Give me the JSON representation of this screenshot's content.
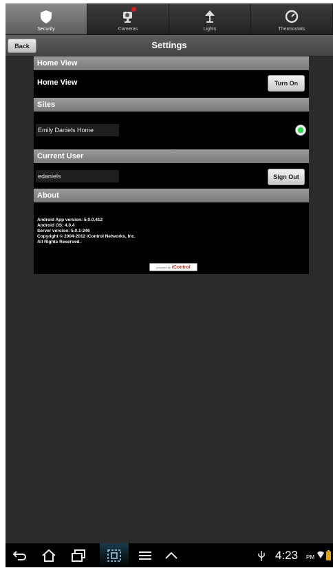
{
  "tabs": [
    {
      "label": "Security",
      "icon": "shield-icon",
      "active": true
    },
    {
      "label": "Cameras",
      "icon": "camera-icon",
      "active": false,
      "alert": true
    },
    {
      "label": "Lights",
      "icon": "lamp-icon",
      "active": false
    },
    {
      "label": "Thermostats",
      "icon": "thermostat-icon",
      "active": false
    }
  ],
  "titlebar": {
    "back_label": "Back",
    "title": "Settings"
  },
  "home_view": {
    "header": "Home View",
    "label": "Home View",
    "button": "Turn On"
  },
  "sites": {
    "header": "Sites",
    "site_name": "Emily Daniels Home",
    "selected": true
  },
  "current_user": {
    "header": "Current User",
    "username": "edaniels",
    "button": "Sign Out"
  },
  "about": {
    "header": "About",
    "lines": [
      "Android App version: 5.0.0.412",
      "Android OS: 4.0.4",
      "Server version: 5.0.1-246",
      "Copyright © 2004-2012 iControl Networks, Inc.",
      "All Rights Reserved."
    ],
    "logo_small": "powered by",
    "logo_text": "iControl"
  },
  "statusbar": {
    "time": "4:23",
    "ampm": "PM"
  },
  "colors": {
    "accent_green": "#35d64d",
    "badge_red": "#d42020",
    "header_gray": "#8a8a8a"
  }
}
